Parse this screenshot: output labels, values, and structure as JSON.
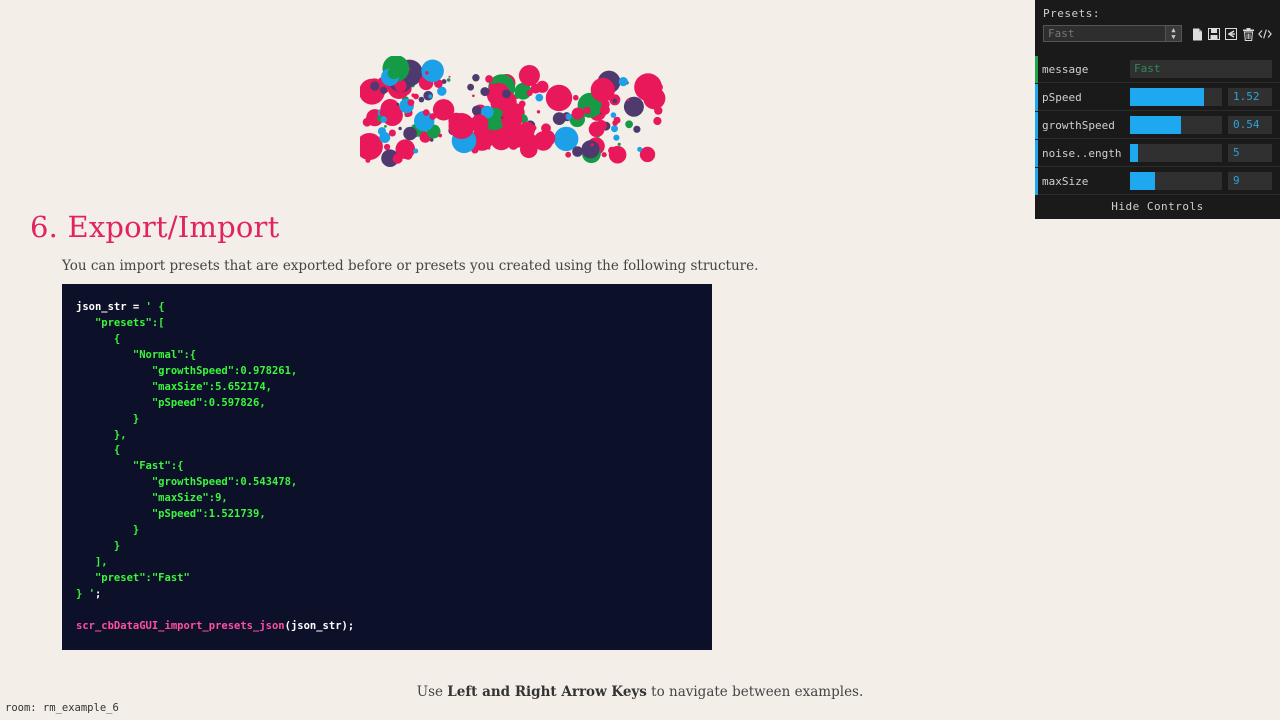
{
  "section": {
    "title": "6. Export/Import",
    "description": "You can import presets that are exported before or presets you created using the following structure."
  },
  "code": {
    "lines": [
      [
        {
          "t": "json_str = ",
          "c": "plain"
        },
        {
          "t": "' {",
          "c": "str"
        }
      ],
      [
        {
          "t": "   \"presets\":[",
          "c": "str"
        }
      ],
      [
        {
          "t": "      {",
          "c": "str"
        }
      ],
      [
        {
          "t": "         \"Normal\":{",
          "c": "str"
        }
      ],
      [
        {
          "t": "            \"growthSpeed\":0.978261,",
          "c": "str"
        }
      ],
      [
        {
          "t": "            \"maxSize\":5.652174,",
          "c": "str"
        }
      ],
      [
        {
          "t": "            \"pSpeed\":0.597826,",
          "c": "str"
        }
      ],
      [
        {
          "t": "         }",
          "c": "str"
        }
      ],
      [
        {
          "t": "      },",
          "c": "str"
        }
      ],
      [
        {
          "t": "      {",
          "c": "str"
        }
      ],
      [
        {
          "t": "         \"Fast\":{",
          "c": "str"
        }
      ],
      [
        {
          "t": "            \"growthSpeed\":0.543478,",
          "c": "str"
        }
      ],
      [
        {
          "t": "            \"maxSize\":9,",
          "c": "str"
        }
      ],
      [
        {
          "t": "            \"pSpeed\":1.521739,",
          "c": "str"
        }
      ],
      [
        {
          "t": "         }",
          "c": "str"
        }
      ],
      [
        {
          "t": "      }",
          "c": "str"
        }
      ],
      [
        {
          "t": "   ],",
          "c": "str"
        }
      ],
      [
        {
          "t": "   \"preset\":\"Fast\"",
          "c": "str"
        }
      ],
      [
        {
          "t": "} '",
          "c": "str"
        },
        {
          "t": ";",
          "c": "plain"
        }
      ],
      [
        {
          "t": "",
          "c": "plain"
        }
      ],
      [
        {
          "t": "scr_cbDataGUI_import_presets_json",
          "c": "fn"
        },
        {
          "t": "(json_str);",
          "c": "plain"
        }
      ]
    ]
  },
  "footer": {
    "prefix": "Use ",
    "keys": "Left and Right Arrow Keys",
    "suffix": " to navigate between examples."
  },
  "room_label": "room: rm_example_6",
  "gui": {
    "presets_label": "Presets:",
    "selected_preset": "Fast",
    "icons": [
      "new-file-icon",
      "save-icon",
      "import-icon",
      "delete-icon",
      "code-export-icon"
    ],
    "controls": [
      {
        "name": "message",
        "type": "text",
        "value": "Fast",
        "accent": "#1fa34a"
      },
      {
        "name": "pSpeed",
        "type": "slider",
        "value": "1.52",
        "fraction": 0.8,
        "accent": "#1ea8f0"
      },
      {
        "name": "growthSpeed",
        "type": "slider",
        "value": "0.54",
        "fraction": 0.55,
        "accent": "#1ea8f0"
      },
      {
        "name": "noise..ength",
        "type": "slider",
        "value": "5",
        "fraction": 0.09,
        "accent": "#1ea8f0"
      },
      {
        "name": "maxSize",
        "type": "slider",
        "value": "9",
        "fraction": 0.27,
        "accent": "#1ea8f0"
      }
    ],
    "hide_label": "Hide Controls"
  },
  "colors": {
    "accent_heading": "#e0245e",
    "blob_palette": [
      "#e8185a",
      "#4e3a6e",
      "#1ca1e8",
      "#159a45"
    ]
  }
}
